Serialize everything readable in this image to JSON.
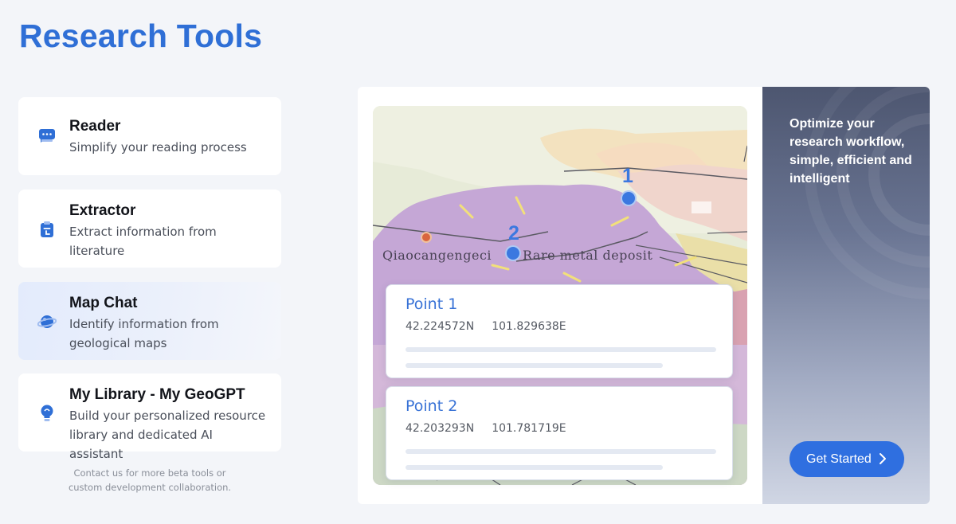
{
  "page": {
    "title": "Research Tools"
  },
  "tools": [
    {
      "title": "Reader",
      "desc": [
        "Simplify your reading process"
      ],
      "icon": "chat-bubble-icon",
      "active": false
    },
    {
      "title": "Extractor",
      "desc": [
        "Extract information from",
        "literature"
      ],
      "icon": "clipboard-icon",
      "active": false
    },
    {
      "title": "Map Chat",
      "desc": [
        "Identify information from",
        "geological maps"
      ],
      "icon": "planet-icon",
      "active": true
    },
    {
      "title": "My Library - My GeoGPT",
      "desc": [
        "Build your personalized resource",
        "library and dedicated AI assistant"
      ],
      "icon": "lightbulb-icon",
      "active": false
    }
  ],
  "contact_note": [
    "Contact us for more beta tools or",
    "custom development collaboration."
  ],
  "map": {
    "labels": {
      "place": "Qiaocangengeci",
      "deposit": "Rare metal deposit"
    },
    "markers": [
      "1",
      "2"
    ],
    "points": [
      {
        "title": "Point 1",
        "lat": "42.224572N",
        "lon": "101.829638E"
      },
      {
        "title": "Point 2",
        "lat": "42.203293N",
        "lon": "101.781719E"
      }
    ]
  },
  "side": {
    "tagline": "Optimize your research workflow, simple, efficient and intelligent",
    "cta_label": "Get Started"
  },
  "colors": {
    "accent": "#2f6fd6",
    "button": "#2f6fe0"
  }
}
